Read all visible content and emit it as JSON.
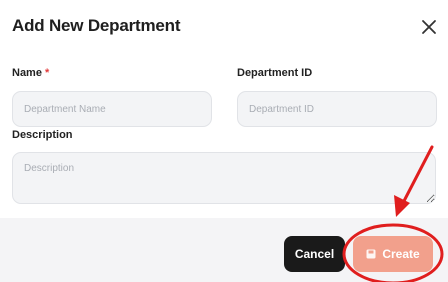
{
  "dialog": {
    "title": "Add New Department",
    "close_icon": "close-icon"
  },
  "form": {
    "name": {
      "label": "Name",
      "required_mark": "*",
      "placeholder": "Department Name",
      "value": ""
    },
    "department_id": {
      "label": "Department ID",
      "placeholder": "Department ID",
      "value": ""
    },
    "description": {
      "label": "Description",
      "placeholder": "Description",
      "value": ""
    }
  },
  "footer": {
    "cancel_label": "Cancel",
    "create_label": "Create",
    "create_icon": "save-icon"
  },
  "annotation": {
    "color": "#e01e1e",
    "arrow_icon": "arrow-icon",
    "highlight": "circle around Create button"
  },
  "colors": {
    "create_button": "#f2a08c",
    "cancel_button": "#1a1a1a",
    "required": "#e23b3b"
  }
}
